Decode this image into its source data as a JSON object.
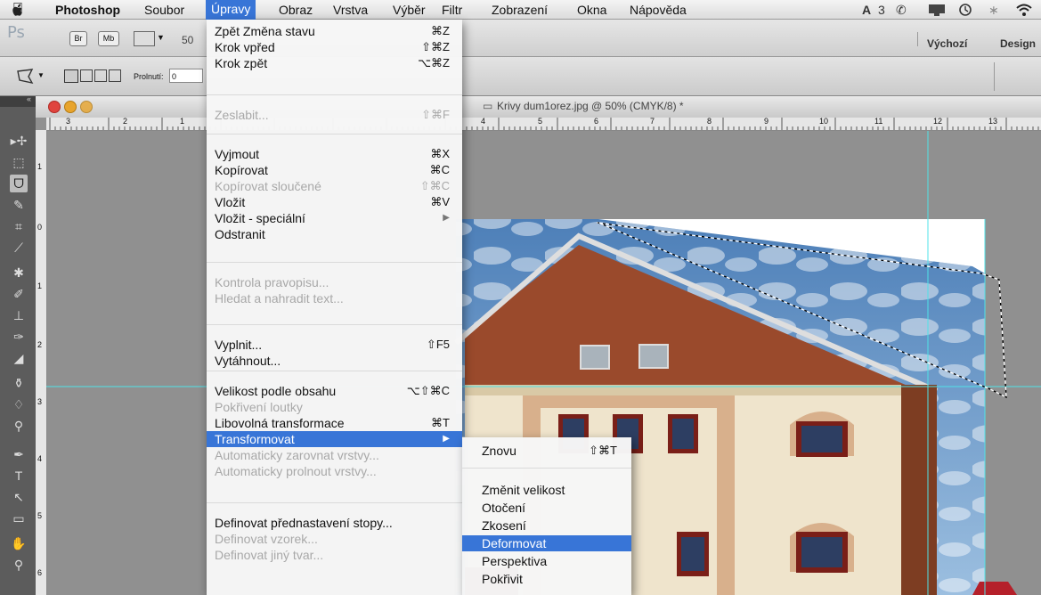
{
  "menubar": {
    "apple": "",
    "app": "Photoshop",
    "items": [
      "Soubor",
      "Úpravy",
      "Obraz",
      "Vrstva",
      "Výběr",
      "Filtr",
      "Zobrazení",
      "Okna",
      "Nápověda"
    ],
    "tray_text": "3"
  },
  "appbar": {
    "logo": "Ps",
    "bridge": "Br",
    "minibridge": "Mb",
    "zoom": "50",
    "workspace_default": "Výchozí",
    "workspace_design": "Design"
  },
  "options": {
    "feather_label": "Prolnutí:",
    "feather_value": "0"
  },
  "document": {
    "title": "Krivy dum1orez.jpg @ 50% (CMYK/8) *",
    "hruler_labels": [
      "3",
      "2",
      "1",
      "4",
      "5",
      "6",
      "7",
      "8",
      "9",
      "10",
      "11",
      "12",
      "13"
    ],
    "vruler_labels": [
      "1",
      "0",
      "1",
      "2",
      "3",
      "4",
      "5",
      "6"
    ]
  },
  "edit_menu": {
    "groups": [
      [
        {
          "label": "Zpět Změna stavu",
          "shortcut": "⌘Z",
          "disabled": false
        },
        {
          "label": "Krok vpřed",
          "shortcut": "⇧⌘Z",
          "disabled": false
        },
        {
          "label": "Krok zpět",
          "shortcut": "⌥⌘Z",
          "disabled": false
        }
      ],
      [
        {
          "label": "Zeslabit...",
          "shortcut": "⇧⌘F",
          "disabled": true
        }
      ],
      [
        {
          "label": "Vyjmout",
          "shortcut": "⌘X",
          "disabled": false
        },
        {
          "label": "Kopírovat",
          "shortcut": "⌘C",
          "disabled": false
        },
        {
          "label": "Kopírovat sloučené",
          "shortcut": "⇧⌘C",
          "disabled": true
        },
        {
          "label": "Vložit",
          "shortcut": "⌘V",
          "disabled": false
        },
        {
          "label": "Vložit - speciální",
          "shortcut": "▶",
          "disabled": false
        },
        {
          "label": "Odstranit",
          "shortcut": "",
          "disabled": false
        }
      ],
      [
        {
          "label": "Kontrola pravopisu...",
          "shortcut": "",
          "disabled": true
        },
        {
          "label": "Hledat a nahradit text...",
          "shortcut": "",
          "disabled": true
        }
      ],
      [
        {
          "label": "Vyplnit...",
          "shortcut": "⇧F5",
          "disabled": false
        },
        {
          "label": "Vytáhnout...",
          "shortcut": "",
          "disabled": false
        }
      ],
      [
        {
          "label": "Velikost podle obsahu",
          "shortcut": "⌥⇧⌘C",
          "disabled": false
        },
        {
          "label": "Pokřivení loutky",
          "shortcut": "",
          "disabled": true
        },
        {
          "label": "Libovolná transformace",
          "shortcut": "⌘T",
          "disabled": false
        },
        {
          "label": "Transformovat",
          "shortcut": "▶",
          "disabled": false,
          "highlighted": true
        },
        {
          "label": "Automaticky zarovnat vrstvy...",
          "shortcut": "",
          "disabled": true
        },
        {
          "label": "Automaticky prolnout vrstvy...",
          "shortcut": "",
          "disabled": true
        }
      ],
      [
        {
          "label": "Definovat přednastavení stopy...",
          "shortcut": "",
          "disabled": false
        },
        {
          "label": "Definovat vzorek...",
          "shortcut": "",
          "disabled": true
        },
        {
          "label": "Definovat jiný tvar...",
          "shortcut": "",
          "disabled": true
        }
      ]
    ]
  },
  "transform_submenu": {
    "items": [
      {
        "label": "Znovu",
        "shortcut": "⇧⌘T"
      },
      {
        "label": "Změnit velikost",
        "shortcut": ""
      },
      {
        "label": "Otočení",
        "shortcut": ""
      },
      {
        "label": "Zkosení",
        "shortcut": ""
      },
      {
        "label": "Deformovat",
        "shortcut": "",
        "highlighted": true
      },
      {
        "label": "Perspektiva",
        "shortcut": ""
      },
      {
        "label": "Pokřivit",
        "shortcut": ""
      }
    ]
  },
  "colors": {
    "highlight": "#3875d7",
    "menu_bg": "#f6f6f6",
    "disabled_text": "#a8a8a8",
    "canvas_bg": "#909090",
    "guide": "#4fe3e8",
    "brick": "#9a4a2c",
    "facade": "#efe4cc"
  }
}
